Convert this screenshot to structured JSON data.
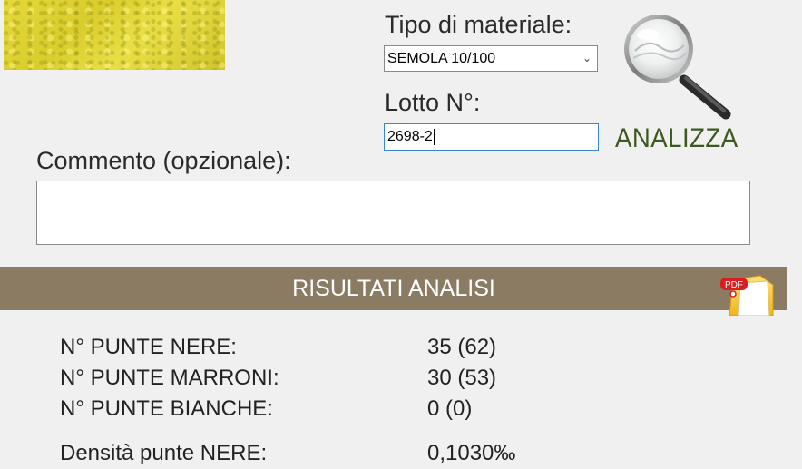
{
  "form": {
    "material_label": "Tipo di materiale:",
    "material_value": "SEMOLA 10/100",
    "lot_label": "Lotto N°:",
    "lot_value": "2698-2",
    "analyze_label": "ANALIZZA",
    "comment_label": "Commento (opzionale):",
    "comment_value": ""
  },
  "results": {
    "title": "RISULTATI ANALISI",
    "rows": [
      {
        "label": "N° PUNTE NERE:",
        "value": "35 (62)"
      },
      {
        "label": "N° PUNTE MARRONI:",
        "value": "30 (53)"
      },
      {
        "label": "N° PUNTE BIANCHE:",
        "value": "0 (0)"
      },
      {
        "label": "Densità punte NERE:",
        "value": "0,1030‰"
      }
    ]
  },
  "icons": {
    "magnifier": "magnifier-icon",
    "pdf": "pdf-icon",
    "dropdown": "chevron-down-icon"
  },
  "colors": {
    "accent_green": "#3c5a1e",
    "results_bar": "#8b7b62",
    "input_focus_border": "#3a86d6",
    "sample_yellow": "#e0d53a"
  }
}
